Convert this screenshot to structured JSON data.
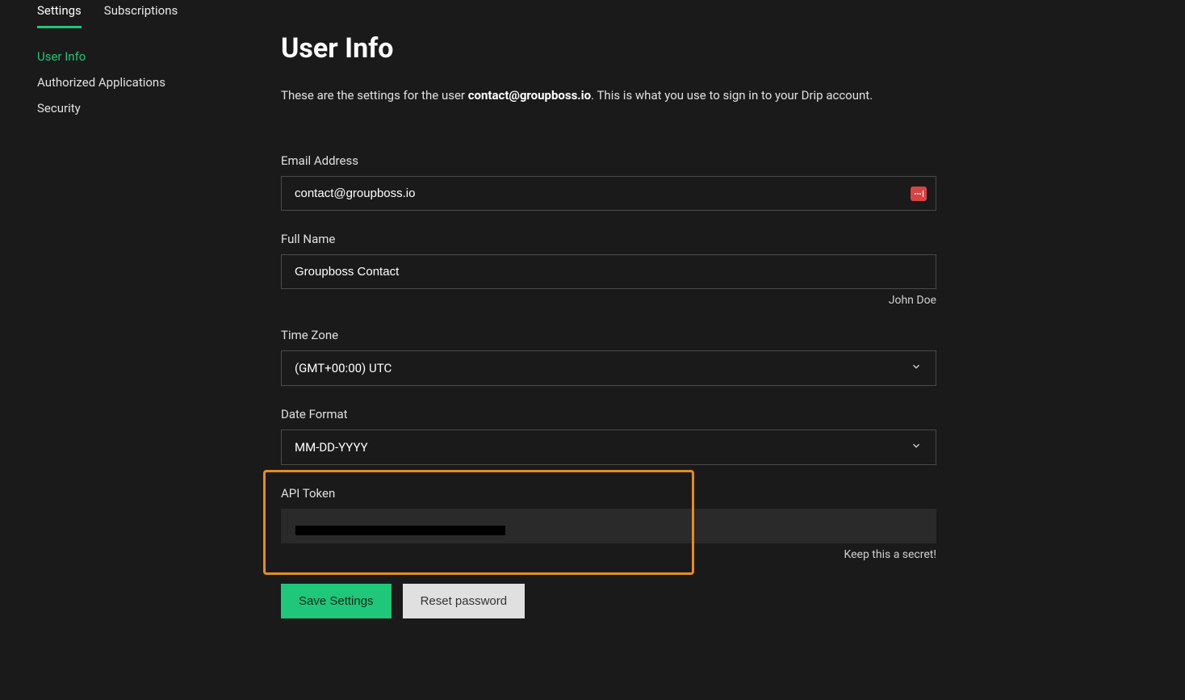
{
  "tabs": {
    "settings": "Settings",
    "subscriptions": "Subscriptions"
  },
  "sidebar": {
    "items": [
      {
        "label": "User Info",
        "active": true
      },
      {
        "label": "Authorized Applications",
        "active": false
      },
      {
        "label": "Security",
        "active": false
      }
    ]
  },
  "page": {
    "title": "User Info",
    "desc_prefix": "These are the settings for the user ",
    "desc_email": "contact@groupboss.io",
    "desc_suffix": ". This is what you use to sign in to your Drip account."
  },
  "form": {
    "email_label": "Email Address",
    "email_value": "contact@groupboss.io",
    "fullname_label": "Full Name",
    "fullname_value": "Groupboss Contact",
    "fullname_hint": "John Doe",
    "timezone_label": "Time Zone",
    "timezone_value": "(GMT+00:00) UTC",
    "dateformat_label": "Date Format",
    "dateformat_value": "MM-DD-YYYY",
    "apitoken_label": "API Token",
    "apitoken_value": "",
    "apitoken_hint": "Keep this a secret!"
  },
  "buttons": {
    "save": "Save Settings",
    "reset": "Reset password"
  }
}
